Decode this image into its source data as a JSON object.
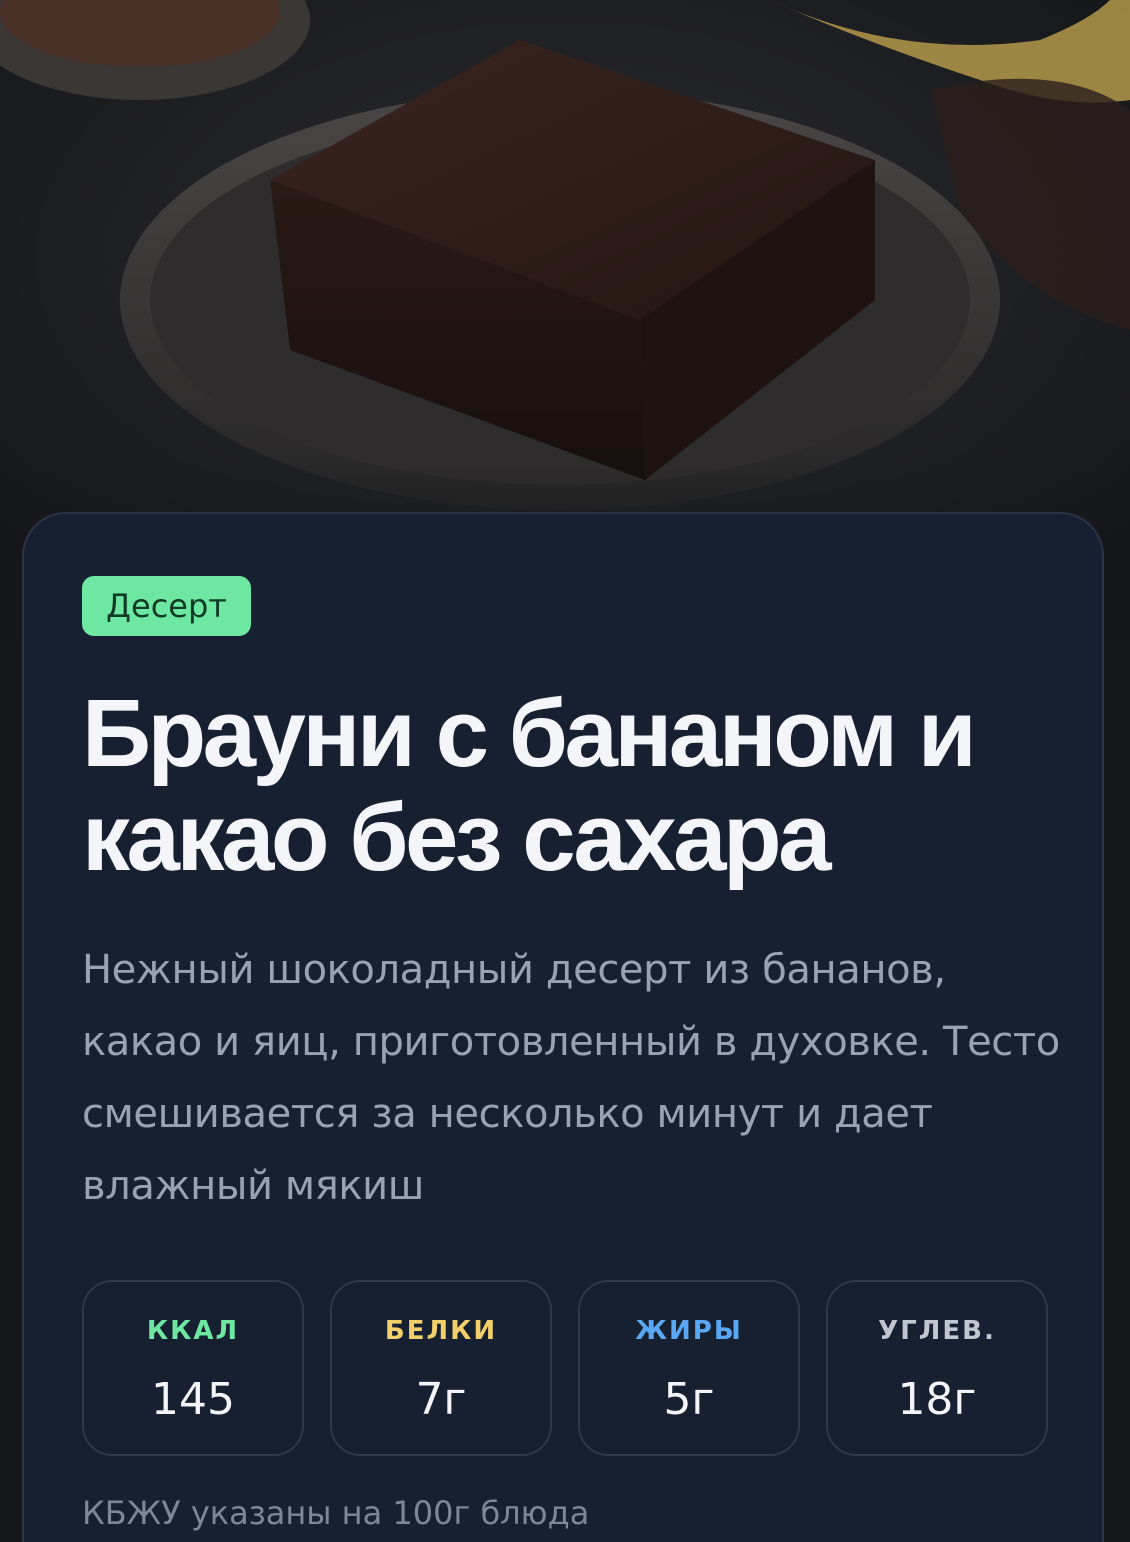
{
  "recipe": {
    "category": "Десерт",
    "title": "Брауни с бананом и какао без сахара",
    "description": "Нежный шоколадный десерт из бананов, какао и яиц, приготовленный в духовке. Тесто смешивается за несколько минут и дает влажный мякиш"
  },
  "macros": [
    {
      "label": "ККАЛ",
      "value": "145",
      "color": "#6ee7a3"
    },
    {
      "label": "БЕЛКИ",
      "value": "7г",
      "color": "#f2cf6b"
    },
    {
      "label": "ЖИРЫ",
      "value": "5г",
      "color": "#5aa8f5"
    },
    {
      "label": "УГЛЕВ.",
      "value": "18г",
      "color": "#c0c6d0"
    }
  ],
  "macros_note": "КБЖУ указаны на 100г блюда",
  "colors": {
    "badge_bg": "#6ee7a3",
    "card_bg": "#172030",
    "title_text": "#f3f5f9",
    "description_text": "#98a2b3"
  }
}
